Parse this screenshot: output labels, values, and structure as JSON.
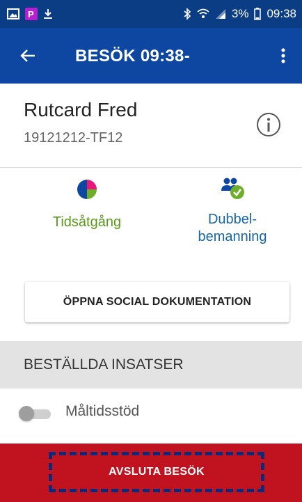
{
  "status_bar": {
    "battery": "3%",
    "time": "09:38",
    "icons": [
      "image-notification-icon",
      "p-notification-icon",
      "download-icon",
      "bluetooth-icon",
      "wifi-icon",
      "signal-icon",
      "battery-icon"
    ]
  },
  "app_bar": {
    "title": "BESÖK 09:38-",
    "back_icon": "arrow-back-icon",
    "menu_icon": "more-vert-icon"
  },
  "patient": {
    "name": "Rutcard Fred",
    "id": "19121212-TF12",
    "info_icon": "info-icon"
  },
  "actions": [
    {
      "label": "Tidsåtgång",
      "icon": "pie-chart-icon",
      "color": "#5a9a1a"
    },
    {
      "label_line1": "Dubbel-",
      "label_line2": "bemanning",
      "icon": "double-staffing-icon",
      "color": "#1565a8"
    }
  ],
  "social_button": {
    "label": "ÖPPNA SOCIAL DOKUMENTATION"
  },
  "section": {
    "title": "BESTÄLLDA INSATSER"
  },
  "services": [
    {
      "label": "Måltidsstöd",
      "enabled": false
    }
  ],
  "end_button": {
    "label": "AVSLUTA BESÖK"
  },
  "colors": {
    "status_bar": "#0b3d84",
    "app_bar": "#0d47a1",
    "end_bar": "#c1121f",
    "focus_dash": "#0d2a78",
    "section_bg": "#e3e3e3"
  }
}
